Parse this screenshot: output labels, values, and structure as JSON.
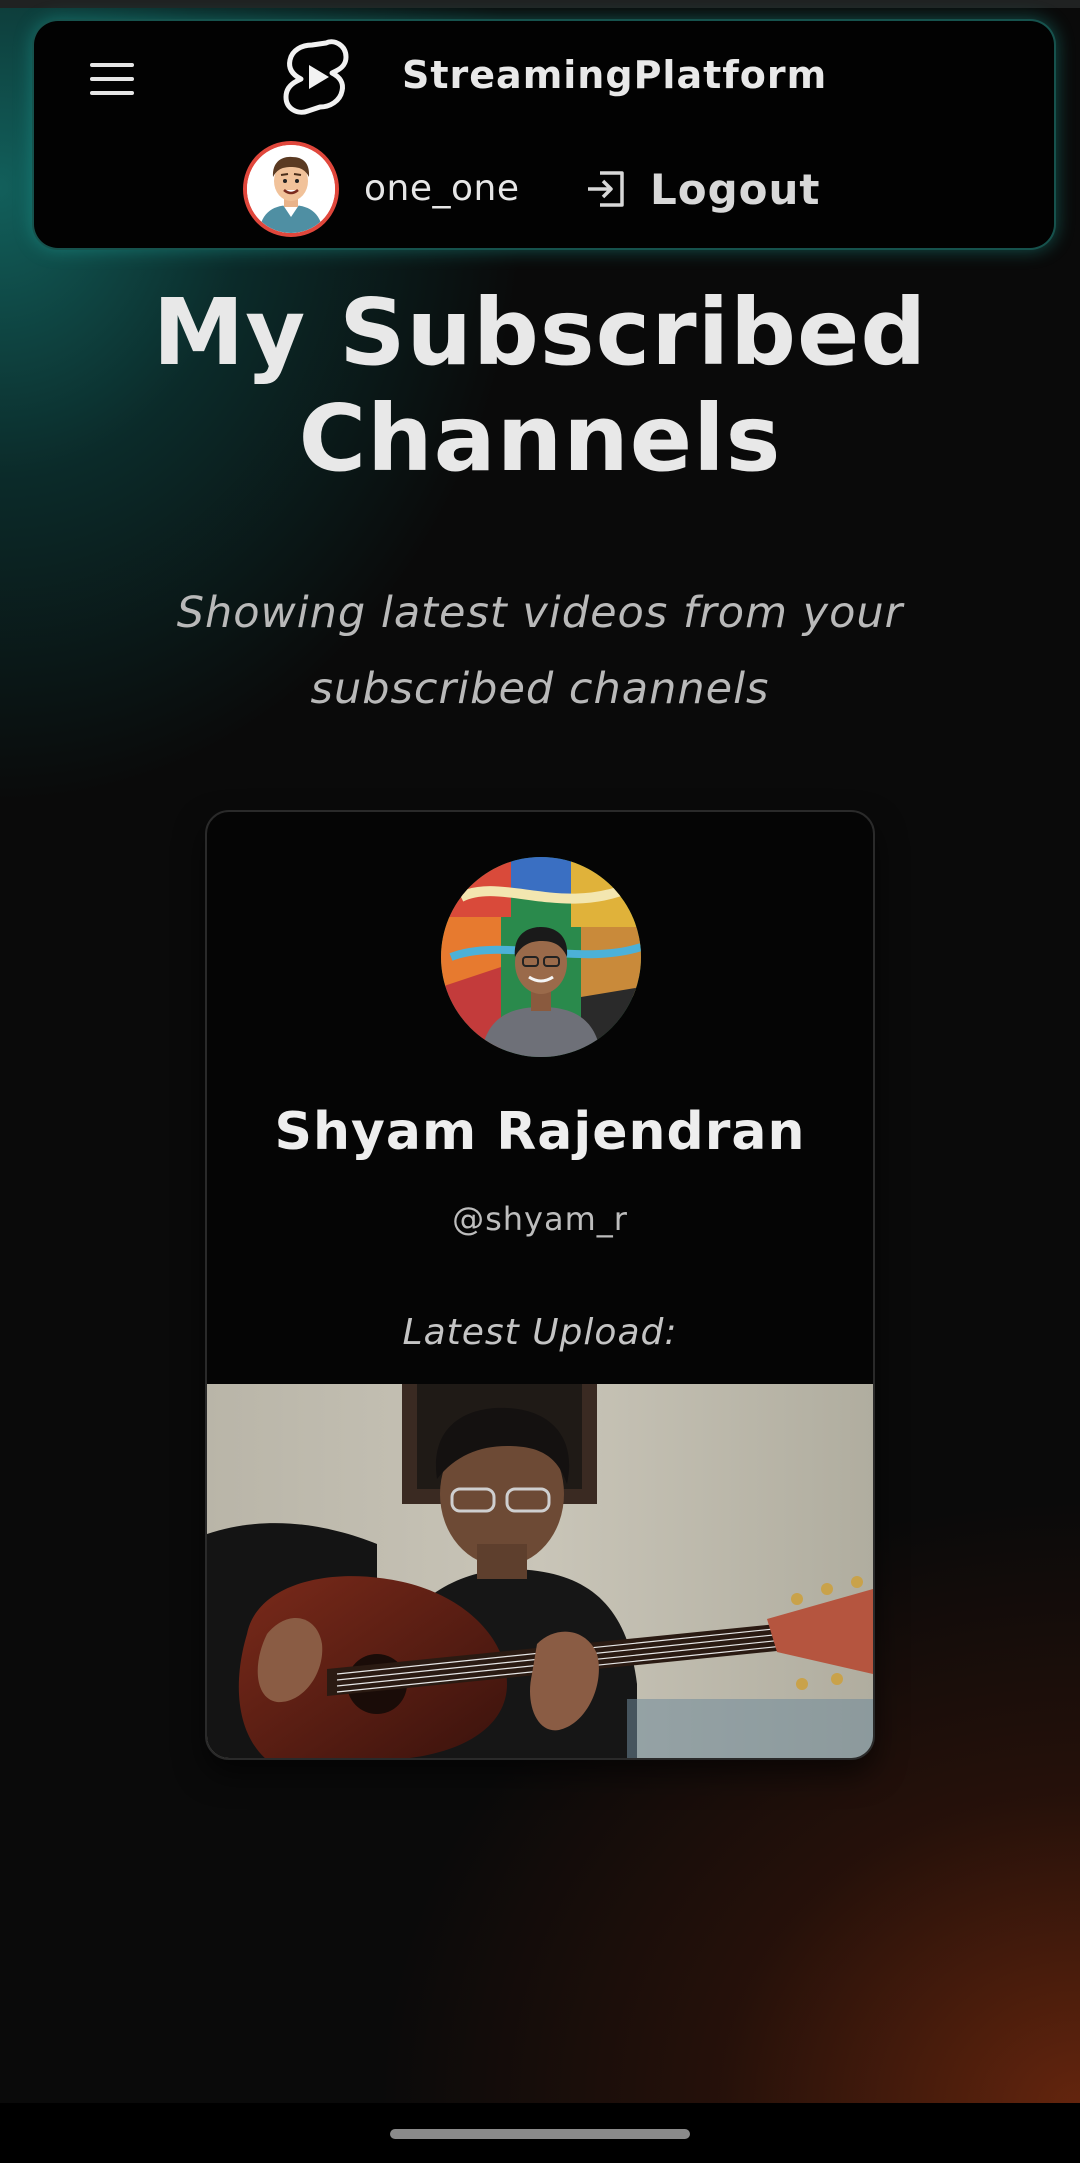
{
  "header": {
    "app_title": "StreamingPlatform",
    "username": "one_one",
    "logout_label": "Logout"
  },
  "page": {
    "title_line1": "My Subscribed",
    "title_line2": "Channels",
    "subtitle_line1": "Showing latest videos from your",
    "subtitle_line2": "subscribed channels"
  },
  "channels": [
    {
      "name": "Shyam Rajendran",
      "handle": "@shyam_r",
      "latest_label": "Latest Upload:"
    }
  ],
  "colors": {
    "accent_teal": "#1e8a84",
    "accent_rust": "#6e280e",
    "avatar_ring": "#e0473c"
  }
}
